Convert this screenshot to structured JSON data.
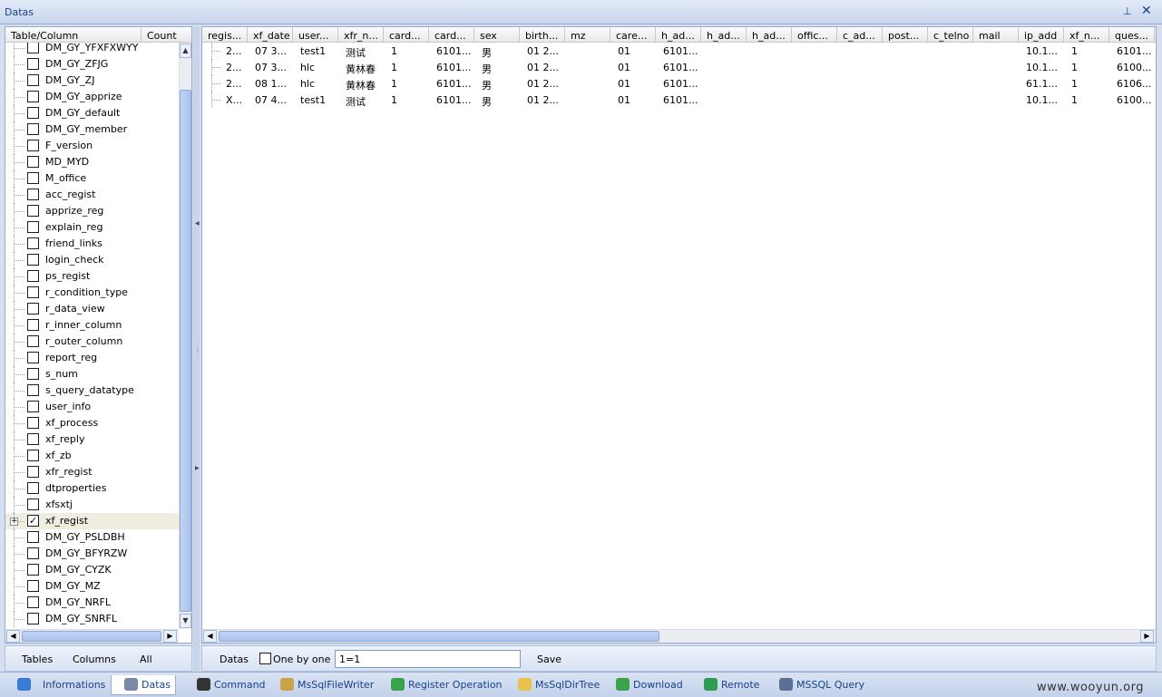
{
  "window": {
    "title": "Datas",
    "pin_glyph": "⊥",
    "close_glyph": "✕"
  },
  "tree": {
    "header_col1": "Table/Column",
    "header_col2": "Count",
    "items": [
      {
        "label": "DM_GY_YFXFXWYY",
        "checked": false
      },
      {
        "label": "DM_GY_ZFJG",
        "checked": false
      },
      {
        "label": "DM_GY_ZJ",
        "checked": false
      },
      {
        "label": "DM_GY_apprize",
        "checked": false
      },
      {
        "label": "DM_GY_default",
        "checked": false
      },
      {
        "label": "DM_GY_member",
        "checked": false
      },
      {
        "label": "F_version",
        "checked": false
      },
      {
        "label": "MD_MYD",
        "checked": false
      },
      {
        "label": "M_office",
        "checked": false
      },
      {
        "label": "acc_regist",
        "checked": false
      },
      {
        "label": "apprize_reg",
        "checked": false
      },
      {
        "label": "explain_reg",
        "checked": false
      },
      {
        "label": "friend_links",
        "checked": false
      },
      {
        "label": "login_check",
        "checked": false
      },
      {
        "label": "ps_regist",
        "checked": false
      },
      {
        "label": "r_condition_type",
        "checked": false
      },
      {
        "label": "r_data_view",
        "checked": false
      },
      {
        "label": "r_inner_column",
        "checked": false
      },
      {
        "label": "r_outer_column",
        "checked": false
      },
      {
        "label": "report_reg",
        "checked": false
      },
      {
        "label": "s_num",
        "checked": false
      },
      {
        "label": "s_query_datatype",
        "checked": false
      },
      {
        "label": "user_info",
        "checked": false
      },
      {
        "label": "xf_process",
        "checked": false
      },
      {
        "label": "xf_reply",
        "checked": false
      },
      {
        "label": "xf_zb",
        "checked": false
      },
      {
        "label": "xfr_regist",
        "checked": false
      },
      {
        "label": "dtproperties",
        "checked": false
      },
      {
        "label": "xfsxtj",
        "checked": false
      },
      {
        "label": "xf_regist",
        "checked": true,
        "expandable": true,
        "selected": true
      },
      {
        "label": "DM_GY_PSLDBH",
        "checked": false
      },
      {
        "label": "DM_GY_BFYRZW",
        "checked": false
      },
      {
        "label": "DM_GY_CYZK",
        "checked": false
      },
      {
        "label": "DM_GY_MZ",
        "checked": false
      },
      {
        "label": "DM_GY_NRFL",
        "checked": false
      },
      {
        "label": "DM_GY_SNRFL",
        "checked": false
      }
    ]
  },
  "grid": {
    "columns": [
      "regis...",
      "xf_date",
      "user...",
      "xfr_n...",
      "card...",
      "card...",
      "sex",
      "birth...",
      "mz",
      "care...",
      "h_ad...",
      "h_ad...",
      "h_ad...",
      "offic...",
      "c_ad...",
      "post...",
      "c_telno",
      "mail",
      "ip_add",
      "xf_n...",
      "ques..."
    ],
    "rows": [
      [
        "2...",
        "07 3...",
        "test1",
        "测试",
        "1",
        "6101...",
        "男",
        "01 2...",
        "",
        "01",
        "6101...",
        "",
        "",
        "",
        "",
        "",
        "",
        "",
        "10.1...",
        "1",
        "6101..."
      ],
      [
        "2...",
        "07 3...",
        "hlc",
        "黄林春",
        "1",
        "6101...",
        "男",
        "01 2...",
        "",
        "01",
        "6101...",
        "",
        "",
        "",
        "",
        "",
        "",
        "",
        "10.1...",
        "1",
        "6100..."
      ],
      [
        "2...",
        "08 1...",
        "hlc",
        "黄林春",
        "1",
        "6101...",
        "男",
        "01 2...",
        "",
        "01",
        "6101...",
        "",
        "",
        "",
        "",
        "",
        "",
        "",
        "61.1...",
        "1",
        "6106..."
      ],
      [
        "X...",
        "07 4...",
        "test1",
        "测试",
        "1",
        "6101...",
        "男",
        "01 2...",
        "",
        "01",
        "6101...",
        "",
        "",
        "",
        "",
        "",
        "",
        "",
        "10.1...",
        "1",
        "6100..."
      ]
    ]
  },
  "left_bar": {
    "tables": "Tables",
    "columns": "Columns",
    "all": "All"
  },
  "grid_bar": {
    "datas": "Datas",
    "one_by_one": "One by one",
    "where_value": "1=1",
    "save": "Save"
  },
  "tabs": [
    {
      "label": "Informations",
      "icon": "info-icon",
      "color": "#3a7bd5"
    },
    {
      "label": "Datas",
      "icon": "database-icon",
      "color": "#7a8aa6",
      "active": true
    },
    {
      "label": "Command",
      "icon": "console-icon",
      "color": "#333333"
    },
    {
      "label": "MsSqlFileWriter",
      "icon": "pencil-icon",
      "color": "#c9a24a"
    },
    {
      "label": "Register Operation",
      "icon": "registry-icon",
      "color": "#3aa24a"
    },
    {
      "label": "MsSqlDirTree",
      "icon": "folder-icon",
      "color": "#e6c14d"
    },
    {
      "label": "Download",
      "icon": "download-icon",
      "color": "#3aa24a"
    },
    {
      "label": "Remote",
      "icon": "globe-icon",
      "color": "#2f9b4f"
    },
    {
      "label": "MSSQL Query",
      "icon": "sql-icon",
      "color": "#5b6f95"
    }
  ],
  "watermark": "www.wooyun.org"
}
